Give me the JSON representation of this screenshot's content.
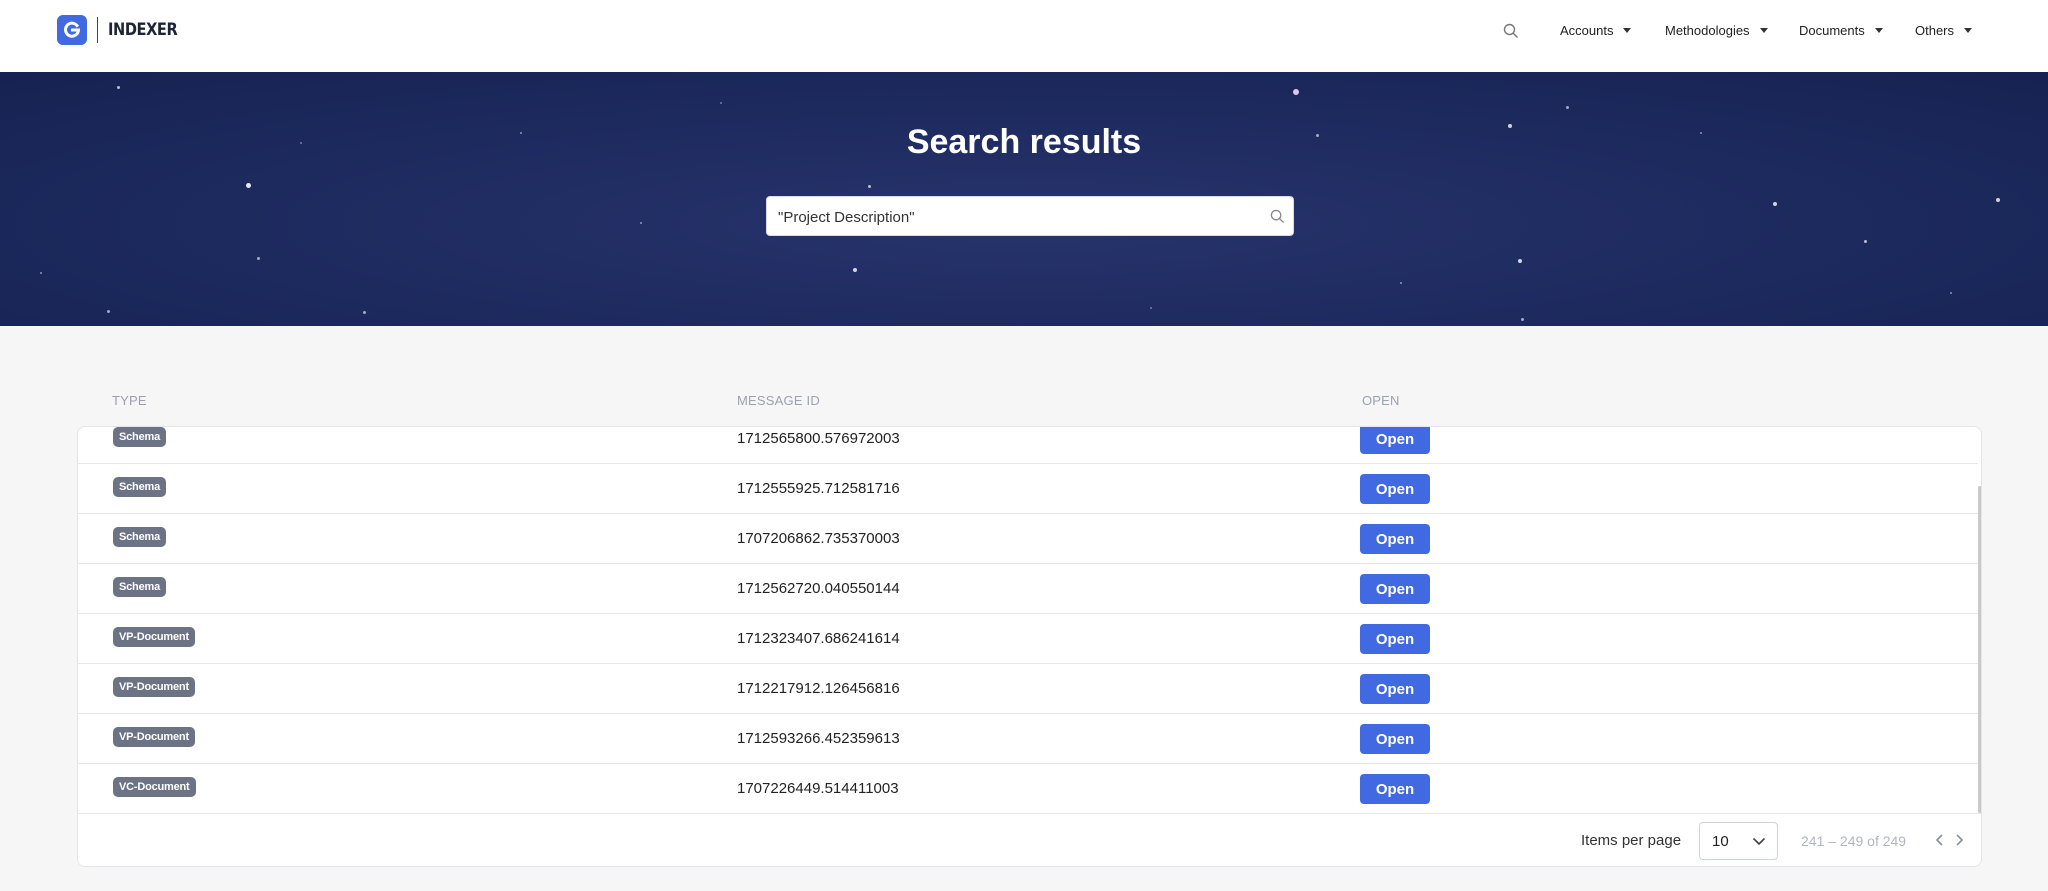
{
  "header": {
    "logo_text": "INDEXER",
    "nav": [
      {
        "label": "Accounts"
      },
      {
        "label": "Methodologies"
      },
      {
        "label": "Documents"
      },
      {
        "label": "Others"
      }
    ]
  },
  "hero": {
    "title": "Search results",
    "search_value": "\"Project Description\""
  },
  "table": {
    "columns": [
      "TYPE",
      "MESSAGE ID",
      "OPEN"
    ],
    "rows": [
      {
        "type": "Schema",
        "message_id": "1712565800.576972003",
        "action": "Open"
      },
      {
        "type": "Schema",
        "message_id": "1712555925.712581716",
        "action": "Open"
      },
      {
        "type": "Schema",
        "message_id": "1707206862.735370003",
        "action": "Open"
      },
      {
        "type": "Schema",
        "message_id": "1712562720.040550144",
        "action": "Open"
      },
      {
        "type": "VP-Document",
        "message_id": "1712323407.686241614",
        "action": "Open"
      },
      {
        "type": "VP-Document",
        "message_id": "1712217912.126456816",
        "action": "Open"
      },
      {
        "type": "VP-Document",
        "message_id": "1712593266.452359613",
        "action": "Open"
      },
      {
        "type": "VC-Document",
        "message_id": "1707226449.514411003",
        "action": "Open"
      }
    ]
  },
  "pagination": {
    "items_per_page_label": "Items per page",
    "items_per_page_value": "10",
    "range_label": "241 – 249 of 249"
  },
  "colors": {
    "accent": "#4169e1",
    "hero_bg": "#1d2a5e",
    "badge_bg": "#6b7385"
  }
}
